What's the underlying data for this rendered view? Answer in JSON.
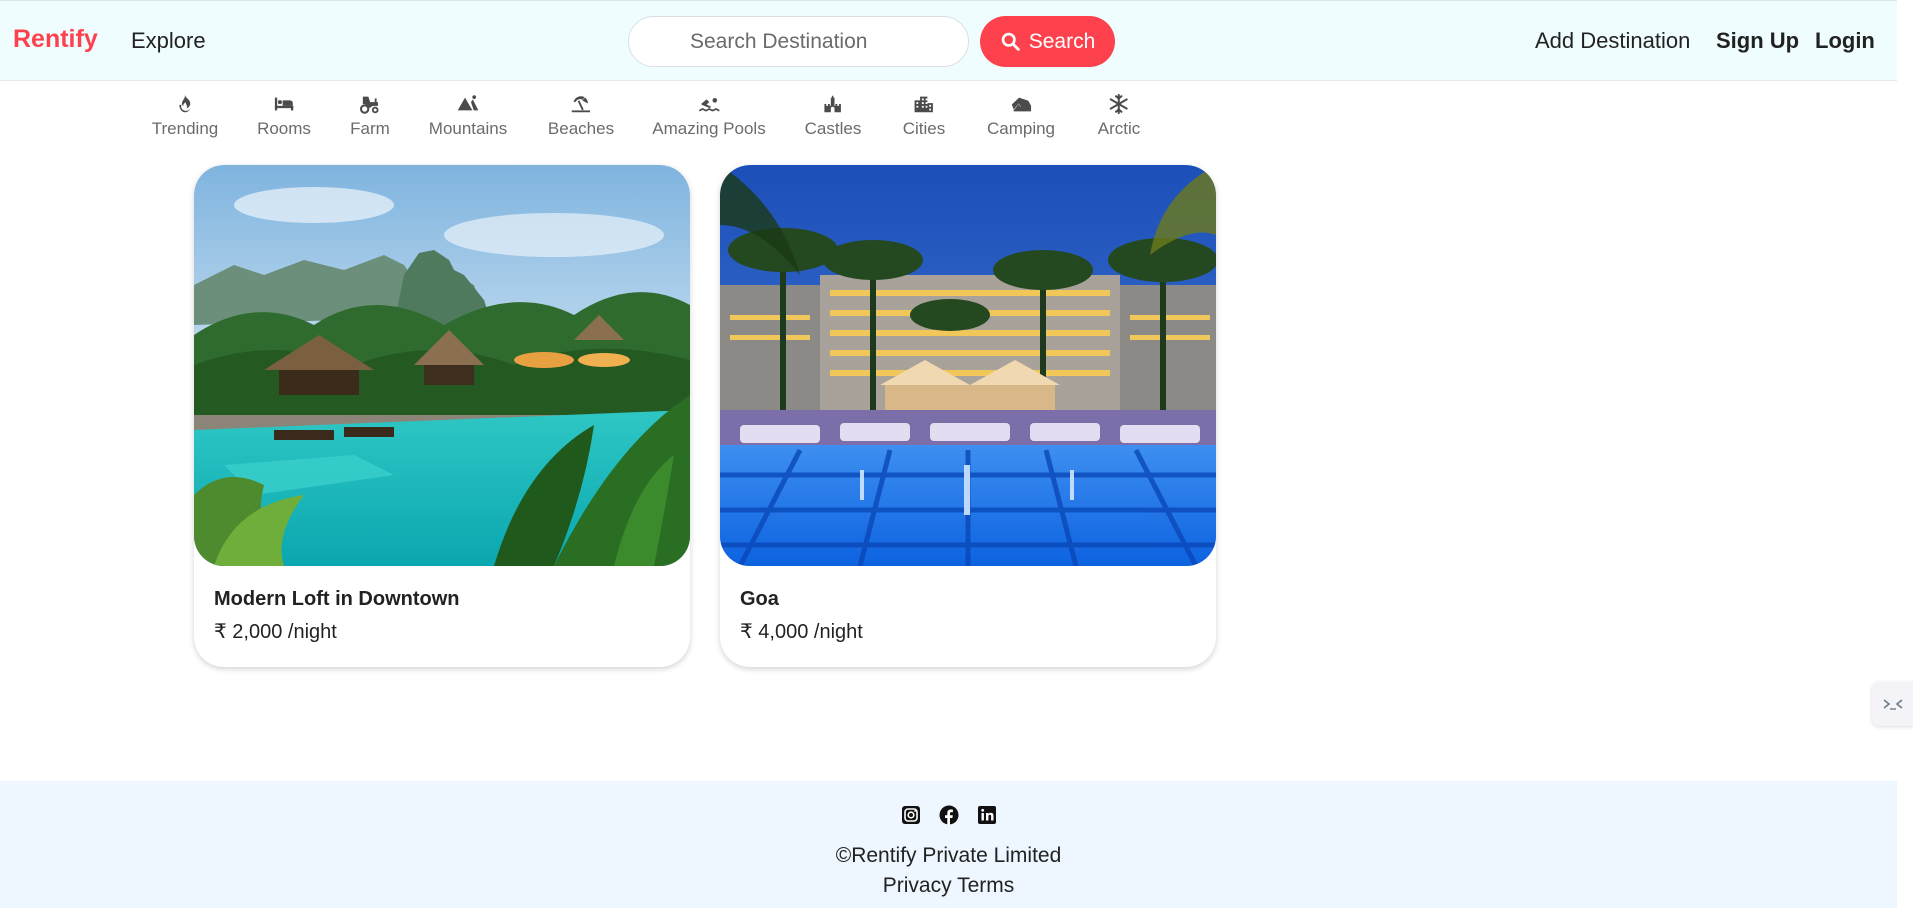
{
  "navbar": {
    "brand": "Rentify",
    "explore": "Explore",
    "search_placeholder": "Search Destination",
    "search_button": "Search",
    "add_destination": "Add Destination",
    "sign_up": "Sign Up",
    "login": "Login",
    "brand_color": "#fe424d"
  },
  "filters": [
    {
      "label": "Trending",
      "icon": "fire-icon"
    },
    {
      "label": "Rooms",
      "icon": "bed-icon"
    },
    {
      "label": "Farm",
      "icon": "tractor-icon"
    },
    {
      "label": "Mountains",
      "icon": "mountain-icon"
    },
    {
      "label": "Beaches",
      "icon": "umbrella-beach-icon"
    },
    {
      "label": "Amazing Pools",
      "icon": "swimmer-icon"
    },
    {
      "label": "Castles",
      "icon": "castle-icon"
    },
    {
      "label": "Cities",
      "icon": "city-icon"
    },
    {
      "label": "Camping",
      "icon": "campground-icon"
    },
    {
      "label": "Arctic",
      "icon": "snowflake-icon"
    }
  ],
  "listings": [
    {
      "title": "Modern Loft in Downtown",
      "price": "₹ 2,000 /night",
      "image": "tropical-resort-pool-photo"
    },
    {
      "title": "Goa",
      "price": "₹ 4,000 /night",
      "image": "night-hotel-pool-photo"
    }
  ],
  "footer": {
    "social_icons": [
      "instagram-icon",
      "facebook-icon",
      "linkedin-icon"
    ],
    "copyright": "©Rentify Private Limited",
    "privacy": "Privacy",
    "terms": "Terms"
  }
}
